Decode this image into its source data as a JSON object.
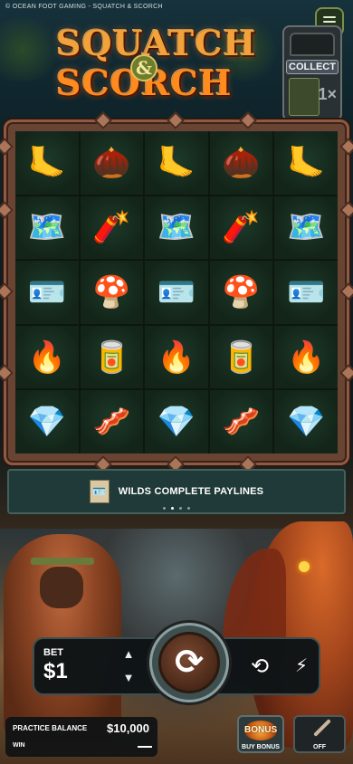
{
  "topbar": {
    "title": "© OCEAN FOOT GAMING - SQUATCH & SCORCH"
  },
  "logo": {
    "word1": "SQUATCH",
    "amp": "&",
    "word2": "SCORCH"
  },
  "collect": {
    "label": "COLLECT",
    "multiplier": "1×"
  },
  "reels": [
    [
      "🦶",
      "🌰",
      "🦶",
      "🌰",
      "🦶"
    ],
    [
      "🗺️",
      "🧨",
      "🗺️",
      "🧨",
      "🗺️"
    ],
    [
      "🪪",
      "🍄",
      "🪪",
      "🍄",
      "🪪"
    ],
    [
      "🔥",
      "🥫",
      "🔥",
      "🥫",
      "🔥"
    ],
    [
      "💎",
      "🥓",
      "💎",
      "🥓",
      "💎"
    ]
  ],
  "banner": {
    "text": "WILDS COMPLETE PAYLINES",
    "icon": "ranger-card-icon"
  },
  "carousel": {
    "active_index": 1,
    "count": 4
  },
  "controls": {
    "bet_label": "BET",
    "bet_value": "$1",
    "increase_icon": "chevron-up-icon",
    "decrease_icon": "chevron-down-icon",
    "spin_icon": "refresh-icon",
    "autoplay_icon": "autoplay-icon",
    "turbo_icon": "lightning-icon"
  },
  "balance": {
    "label": "PRACTICE BALANCE",
    "value": "$10,000",
    "win_label": "WIN"
  },
  "buy_bonus": {
    "badge": "BONUS",
    "label": "BUY BONUS"
  },
  "off_button": {
    "label": "OFF"
  }
}
